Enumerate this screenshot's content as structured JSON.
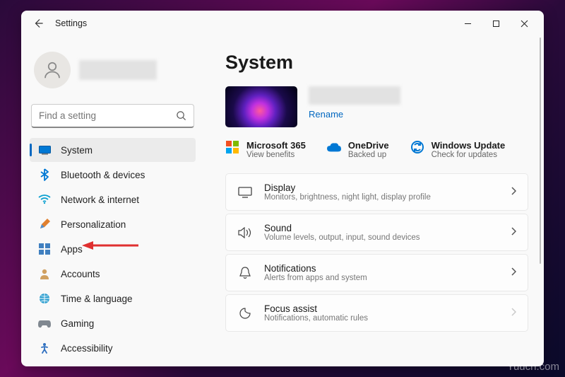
{
  "titlebar": {
    "title": "Settings"
  },
  "search": {
    "placeholder": "Find a setting"
  },
  "sidebar": {
    "items": [
      {
        "label": "System"
      },
      {
        "label": "Bluetooth & devices"
      },
      {
        "label": "Network & internet"
      },
      {
        "label": "Personalization"
      },
      {
        "label": "Apps"
      },
      {
        "label": "Accounts"
      },
      {
        "label": "Time & language"
      },
      {
        "label": "Gaming"
      },
      {
        "label": "Accessibility"
      }
    ]
  },
  "page": {
    "title": "System",
    "rename": "Rename",
    "status": [
      {
        "title": "Microsoft 365",
        "sub": "View benefits"
      },
      {
        "title": "OneDrive",
        "sub": "Backed up"
      },
      {
        "title": "Windows Update",
        "sub": "Check for updates"
      }
    ],
    "cards": [
      {
        "title": "Display",
        "sub": "Monitors, brightness, night light, display profile"
      },
      {
        "title": "Sound",
        "sub": "Volume levels, output, input, sound devices"
      },
      {
        "title": "Notifications",
        "sub": "Alerts from apps and system"
      },
      {
        "title": "Focus assist",
        "sub": "Notifications, automatic rules"
      }
    ]
  },
  "watermark": "Yuucn.com"
}
